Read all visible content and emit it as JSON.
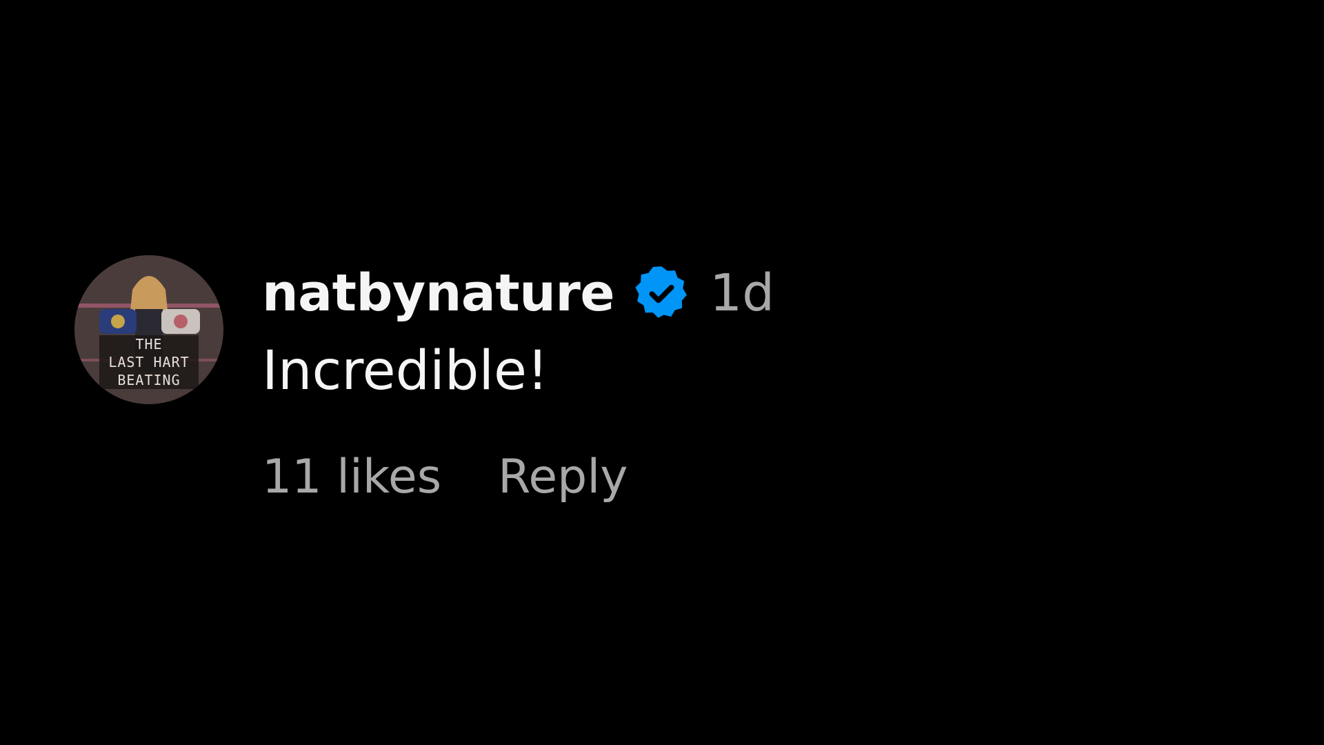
{
  "comment": {
    "avatar": {
      "overlay_lines": [
        "THE",
        "LAST HART",
        "BEATING"
      ]
    },
    "username": "natbynature",
    "verified_icon": "verified-badge-icon",
    "timestamp": "1d",
    "text": "Incredible!",
    "likes_label": "11 likes",
    "reply_label": "Reply"
  },
  "colors": {
    "background": "#000000",
    "primary_text": "#f5f5f5",
    "secondary_text": "#a8a8a8",
    "verified_blue": "#0095f6"
  }
}
